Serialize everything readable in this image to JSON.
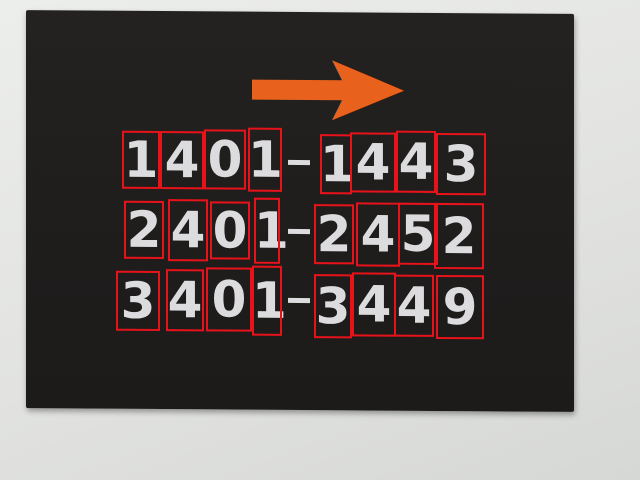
{
  "sign": {
    "background_color": "#201e1d",
    "digit_color": "#dcdcde",
    "arrow_color": "#e8621e",
    "arrow_icon": "arrow-right-icon",
    "box_color": "#e8121a",
    "rows": [
      {
        "start": "1401",
        "end": "1443",
        "chars": [
          "1",
          "4",
          "0",
          "1",
          "-",
          "1",
          "4",
          "4",
          "3"
        ]
      },
      {
        "start": "2401",
        "end": "2452",
        "chars": [
          "2",
          "4",
          "0",
          "1",
          "-",
          "2",
          "4",
          "5",
          "2"
        ]
      },
      {
        "start": "3401",
        "end": "3449",
        "chars": [
          "3",
          "4",
          "0",
          "1",
          "-",
          "3",
          "4",
          "4",
          "9"
        ]
      }
    ]
  }
}
